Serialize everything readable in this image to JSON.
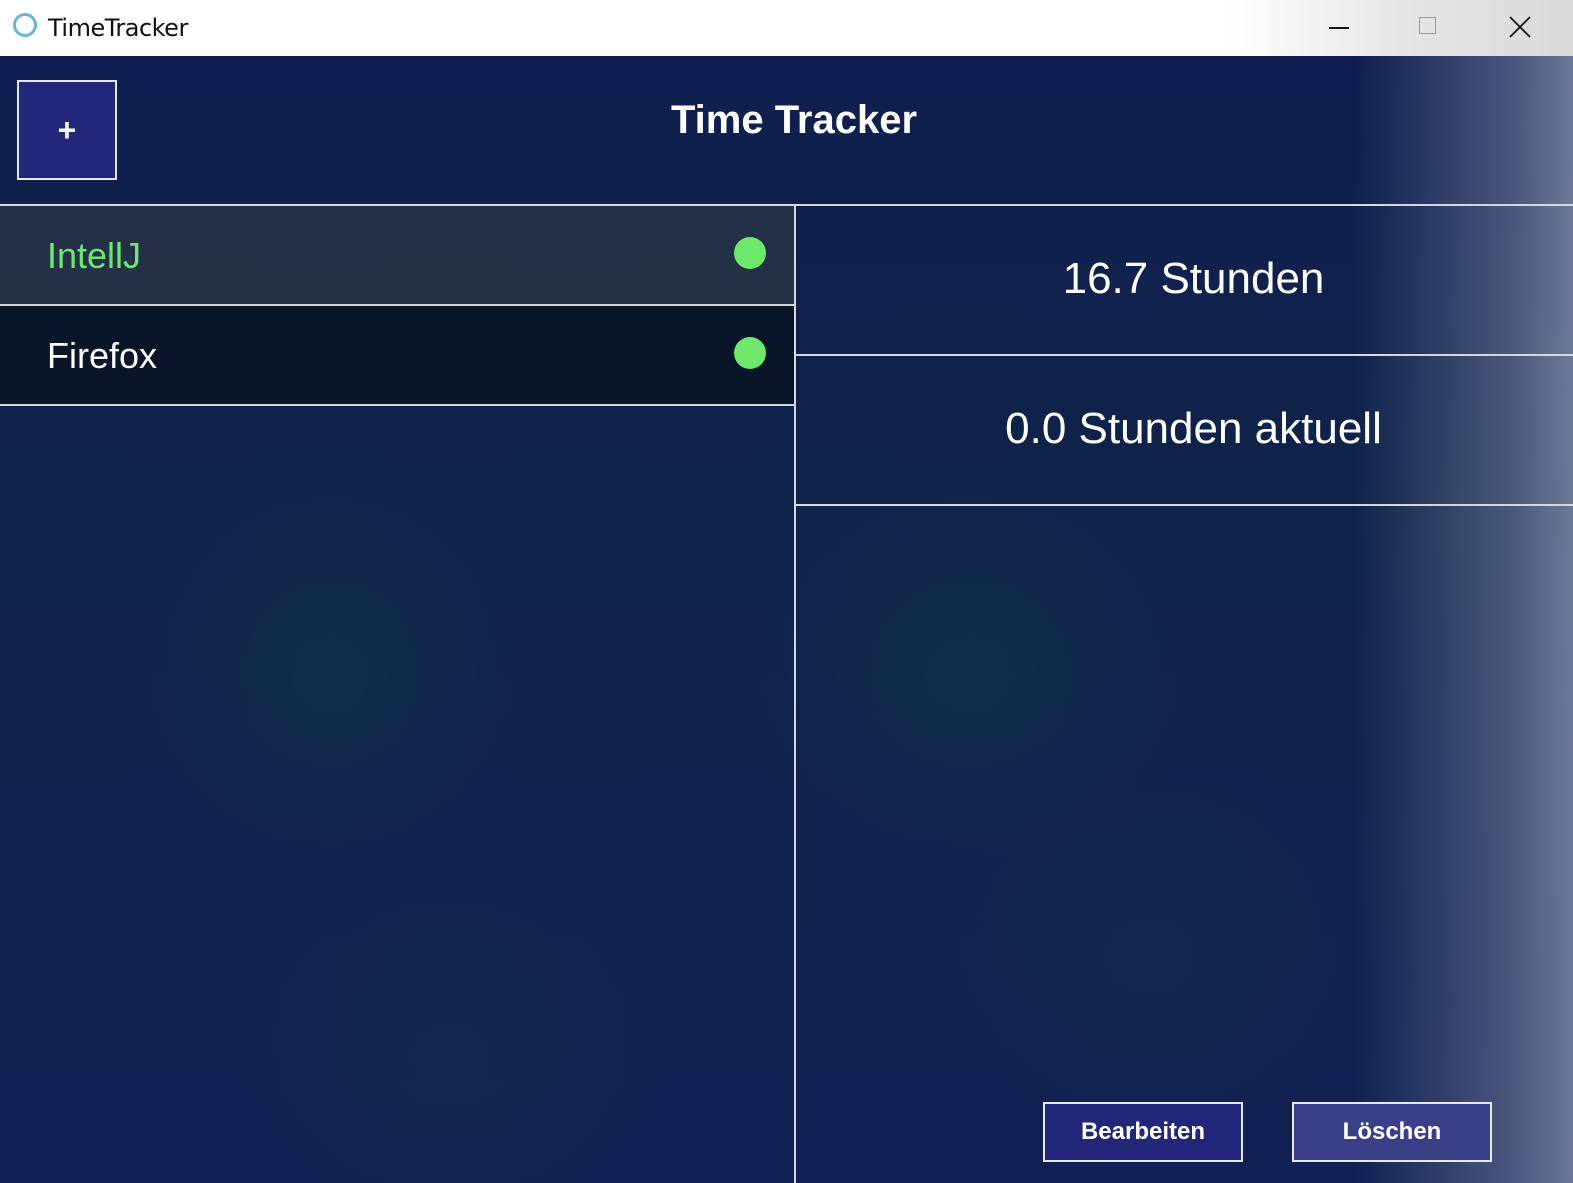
{
  "window": {
    "title": "TimeTracker",
    "controls": [
      "minimize",
      "maximize",
      "close"
    ]
  },
  "header": {
    "add_label": "+",
    "title": "Time Tracker"
  },
  "list": {
    "items": [
      {
        "label": "IntellJ",
        "status_color": "#6ee86a",
        "selected": true
      },
      {
        "label": "Firefox",
        "status_color": "#6ee86a",
        "selected": false
      }
    ]
  },
  "details": {
    "total": "16.7 Stunden",
    "current": "0.0 Stunden aktuell",
    "edit_label": "Bearbeiten",
    "delete_label": "Löschen"
  },
  "colors": {
    "accent_button": "#22277a",
    "active_text": "#6ce86c"
  }
}
